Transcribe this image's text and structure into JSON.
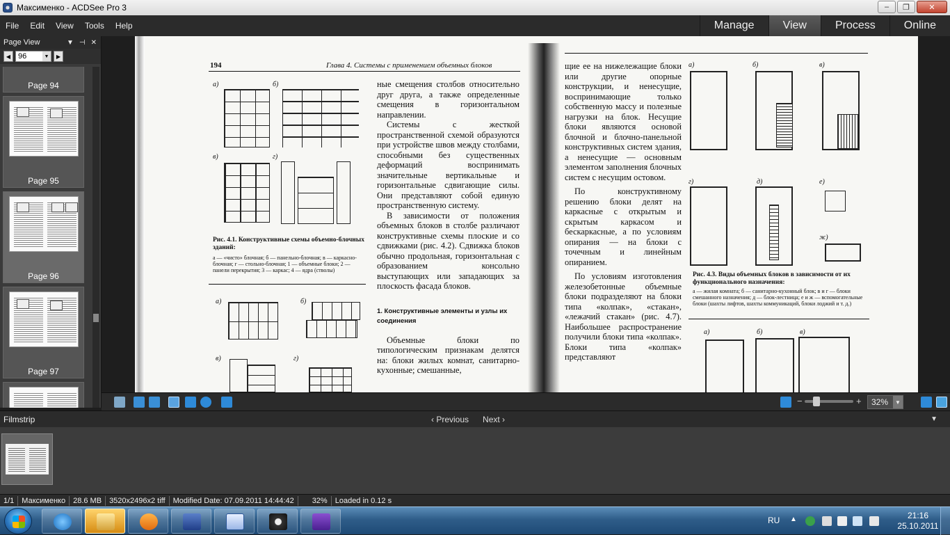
{
  "window": {
    "title": "Максименко - ACDSee Pro 3",
    "controls": {
      "minimize": "–",
      "maximize": "❐",
      "close": "✕"
    }
  },
  "menu": [
    "File",
    "Edit",
    "View",
    "Tools",
    "Help"
  ],
  "modes": [
    {
      "label": "Manage",
      "active": false
    },
    {
      "label": "View",
      "active": true
    },
    {
      "label": "Process",
      "active": false
    },
    {
      "label": "Online",
      "active": false
    }
  ],
  "page_view": {
    "title": "Page View",
    "page_value": "96",
    "pages": [
      {
        "label": "Page 94"
      },
      {
        "label": "Page 95"
      },
      {
        "label": "Page 96"
      },
      {
        "label": "Page 97"
      }
    ]
  },
  "document": {
    "left": {
      "page_number": "194",
      "header": "Глава 4. Системы с применением объемных блоков",
      "fig1_caption_title": "Рис. 4.1. Конструктивные схемы объемно-блочных зданий:",
      "fig1_caption_body": "а — «чисто» блочная; б — панельно-блочная; в — каркасно-блочная; г — стольно-блочная; 1 — объемные блоки; 2 — панели перекрытия; 3 — каркас; 4 — ядра (стволы)",
      "para1": "ные смещения столбов относительно друг друга, а также определенные смещения в горизонтальном направлении.",
      "para2": "Системы с жесткой пространственной схемой образуются при устройстве швов между столбами, способными без существенных деформаций воспринимать значительные вертикальные и горизонтальные сдвигающие силы. Они представляют собой единую пространственную систему.",
      "para3": "В зависимости от положения объемных блоков в столбе различают конструктивные схемы плоские и со сдвижками (рис. 4.2). Сдвижка блоков обычно продольная, горизонтальная с образованием консольно выступающих или западающих за плоскость фасада блоков.",
      "section": "1. Конструктивные элементы и узлы их соединения",
      "para4": "Объемные блоки по типологическим признакам делятся на: блоки жилых комнат, санитарно-кухонные; смешанные,"
    },
    "right": {
      "text": "щие ее на нижележащие блоки или другие опорные конструкции, и ненесущие, воспринимающие только собственную массу и полезные нагрузки на блок. Несущие блоки являются основой блочной и блочно-панельной конструктивных систем здания, а ненесущие — основным элементом заполнения блочных систем с несущим остовом.",
      "para2": "По конструктивному решению блоки делят на каркасные с открытым и скрытым каркасом и бескаркасные, а по условиям опирания — на блоки с точечным и линейным опиранием.",
      "para3": "По условиям изготовления железобетонные объемные блоки подразделяют на блоки типа «колпак», «стакан», «лежачий стакан» (рис. 4.7). Наибольшее распространение получили блоки типа «колпак». Блоки типа «колпак» представляют",
      "fig3_caption_title": "Рис. 4.3. Виды объемных блоков в зависимости от их функционального назначения:",
      "fig3_caption_body": "а — жилая комната; б — санитарно-кухонный блок; в и г — блоки смешанного назначения; д — блок-лестница; е и ж — вспомогательные блоки (шахты лифтов, шахты коммуникаций, блоки лоджий и т. д.)"
    },
    "fig_labels": [
      "а)",
      "б)",
      "в)",
      "г)",
      "д)",
      "е)",
      "ж)"
    ]
  },
  "toolbar": {
    "zoom_value": "32%",
    "zoom_minus": "−",
    "zoom_plus": "+"
  },
  "filmstrip": {
    "title": "Filmstrip",
    "previous": "Previous",
    "next": "Next"
  },
  "status": {
    "position": "1/1",
    "name": "Максименко",
    "size": "28.6 MB",
    "dimensions": "3520x2496x2 tiff",
    "modified": "Modified Date: 07.09.2011 14:44:42",
    "zoom": "32%",
    "loaded": "Loaded in 0.12 s"
  },
  "taskbar": {
    "lang": "RU",
    "time": "21:16",
    "date": "25.10.2011"
  },
  "colors": {
    "accent": "#4aa3df",
    "chrome": "#2b2b2b",
    "panel": "#3a3a3a"
  }
}
